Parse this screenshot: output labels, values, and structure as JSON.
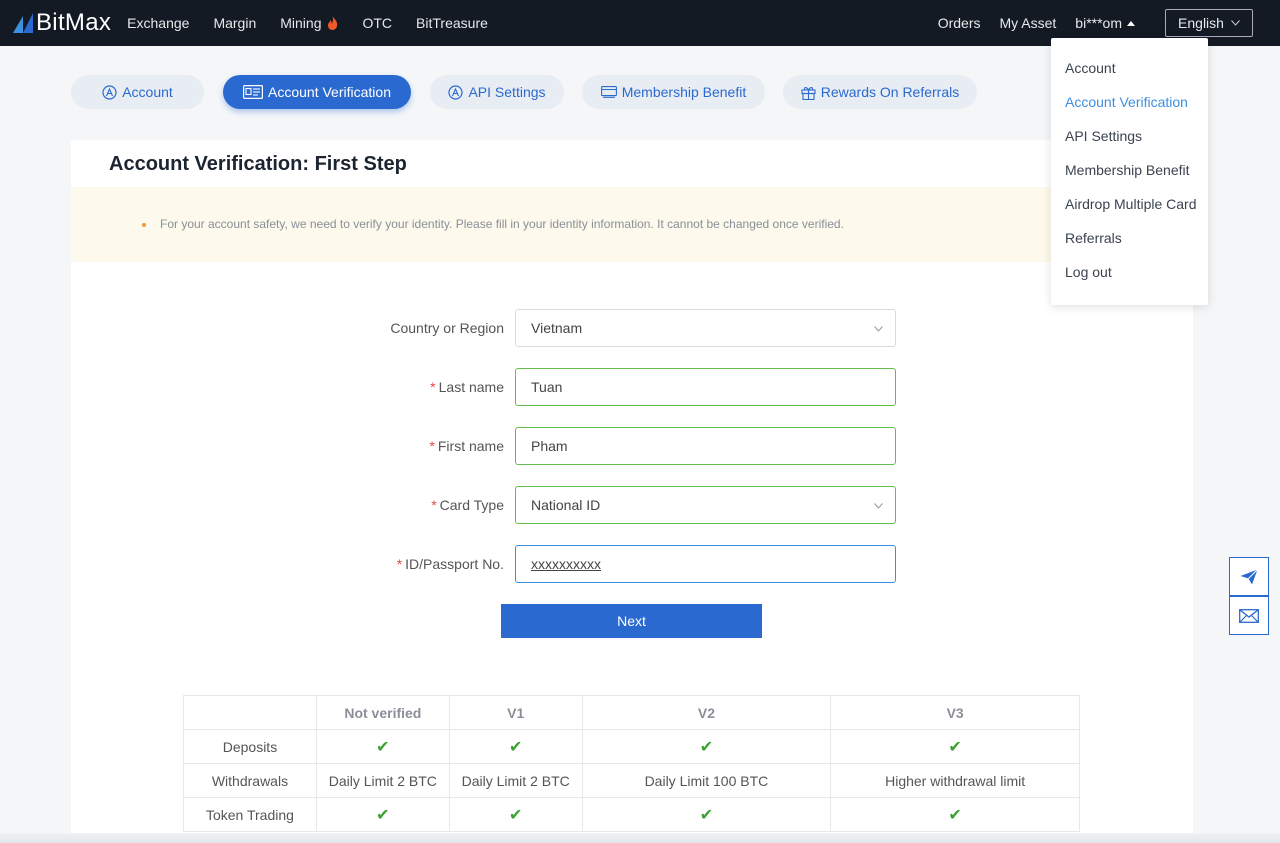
{
  "nav": {
    "brand": "BitMax",
    "links": [
      "Exchange",
      "Margin",
      "Mining",
      "OTC",
      "BitTreasure"
    ],
    "orders": "Orders",
    "my_asset": "My Asset",
    "user": "bi***om",
    "language": "English"
  },
  "tabs": [
    "Account",
    "Account Verification",
    "API Settings",
    "Membership Benefit",
    "Rewards On Referrals"
  ],
  "active_tab": "Account Verification",
  "page": {
    "title": "Account Verification: First Step",
    "notice": "For your account safety, we need to verify your identity. Please fill in your identity information. It cannot be changed once verified."
  },
  "form": {
    "country_label": "Country or Region",
    "country_value": "Vietnam",
    "required_mark": "*",
    "last_name_label": "Last name",
    "last_name_value": "Tuan",
    "first_name_label": "First name",
    "first_name_value": "Pham",
    "card_type_label": "Card Type",
    "card_type_value": "National ID",
    "id_label": "ID/Passport No.",
    "id_value": "xxxxxxxxxx",
    "next_label": "Next"
  },
  "levels_table": {
    "headers": [
      "",
      "Not verified",
      "V1",
      "V2",
      "V3"
    ],
    "rows": [
      [
        "Deposits",
        "✔",
        "✔",
        "✔",
        "✔"
      ],
      [
        "Withdrawals",
        "Daily Limit 2 BTC",
        "Daily Limit 2 BTC",
        "Daily Limit 100 BTC",
        "Higher withdrawal limit"
      ],
      [
        "Token Trading",
        "✔",
        "✔",
        "✔",
        "✔"
      ]
    ]
  },
  "user_menu": {
    "items": [
      "Account",
      "Account Verification",
      "API Settings",
      "Membership Benefit",
      "Airdrop Multiple Card",
      "Referrals",
      "Log out"
    ],
    "active": "Account Verification"
  },
  "colors": {
    "nav_bg": "#131a24",
    "accent": "#2a6ad0",
    "link_active": "#3d8fe0",
    "valid_border": "#61bf4d",
    "required": "#e5483f",
    "check": "#3aa132"
  },
  "icons": {
    "side_buttons": [
      "telegram-icon",
      "mail-icon"
    ]
  }
}
